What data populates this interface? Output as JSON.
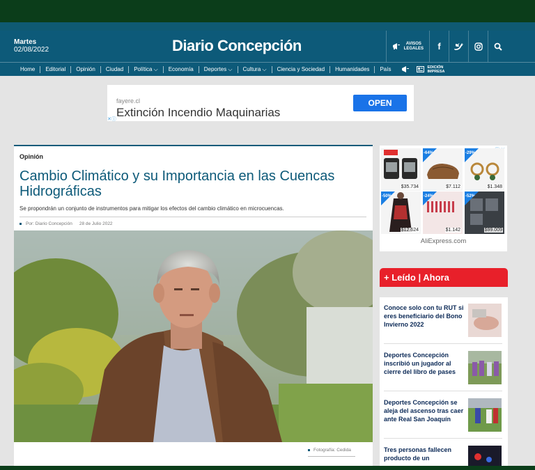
{
  "header": {
    "day": "Martes",
    "date": "02/08/2022",
    "logo": "Diario Concepción",
    "avisos_line1": "AVISOS",
    "avisos_line2": "LEGALES"
  },
  "nav": {
    "items": [
      "Home",
      "Editorial",
      "Opinión",
      "Ciudad",
      "Política ⌵",
      "Economía",
      "Deportes ⌵",
      "Cultura ⌵",
      "Ciencia y Sociedad",
      "Humanidades",
      "País"
    ],
    "edicion_line1": "EDICIÓN",
    "edicion_line2": "IMPRESA"
  },
  "ad": {
    "domain": "fayere.cl",
    "headline": "Extinción Incendio Maquinarias",
    "button": "OPEN"
  },
  "article": {
    "section": "Opinión",
    "title": "Cambio Climático y su Importancia en las Cuencas Hidrográficas",
    "dek": "Se propondrán un conjunto de instrumentos para mitigar los efectos del cambio climático en microcuencas.",
    "author": "Por: Diario Concepción",
    "date": "28 de Julio 2022",
    "caption": "Fotografía: Cedida"
  },
  "aliexpress": {
    "name": "AliExpress.com",
    "products": [
      {
        "price": "$35.734",
        "badge": ""
      },
      {
        "price": "$7.112",
        "badge": "-64%"
      },
      {
        "price": "$1.348",
        "badge": "-29%"
      },
      {
        "price": "$12.624",
        "badge": "-50%"
      },
      {
        "price": "$1.142",
        "badge": "-24%"
      },
      {
        "price": "$99.009",
        "badge": "-52%"
      }
    ]
  },
  "leido": {
    "heading": "+ Leído | Ahora",
    "items": [
      {
        "title": "Conoce solo con tu RUT si eres beneficiario del Bono Invierno 2022"
      },
      {
        "title": "Deportes Concepción inscribió un jugador al cierre del libro de pases"
      },
      {
        "title": "Deportes Concepción se aleja del ascenso tras caer ante Real San Joaquín"
      },
      {
        "title": "Tres personas fallecen producto de un"
      }
    ]
  },
  "colors": {
    "brand": "#0d5a79",
    "top_green": "#0b3d1a",
    "leido_red": "#e8202a",
    "headline_blue": "#0c2a57"
  }
}
